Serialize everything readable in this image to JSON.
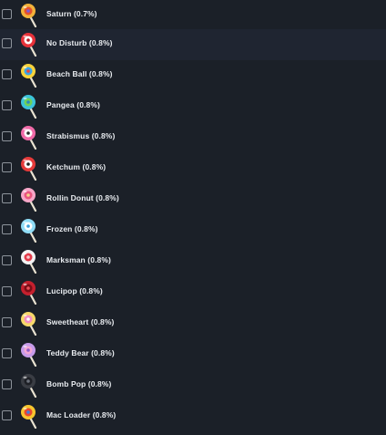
{
  "items": [
    {
      "name": "Saturn (0.7%)",
      "icon": "lollipop-saturn-icon",
      "colors": [
        "#f2b23a",
        "#e4502c",
        "#7b5bd6"
      ],
      "highlighted": false
    },
    {
      "name": "No Disturb (0.8%)",
      "icon": "lollipop-no-disturb-icon",
      "colors": [
        "#e8323a",
        "#ffffff",
        "#b81e26"
      ],
      "highlighted": true
    },
    {
      "name": "Beach Ball (0.8%)",
      "icon": "lollipop-beach-ball-icon",
      "colors": [
        "#f7d23a",
        "#3aa2e8",
        "#e9463a"
      ],
      "highlighted": false
    },
    {
      "name": "Pangea (0.8%)",
      "icon": "lollipop-pangea-icon",
      "colors": [
        "#3cc3d9",
        "#6fd157",
        "#2a8ac0"
      ],
      "highlighted": false
    },
    {
      "name": "Strabismus (0.8%)",
      "icon": "lollipop-strabismus-icon",
      "colors": [
        "#f06aa8",
        "#ffffff",
        "#2a2a2a"
      ],
      "highlighted": false
    },
    {
      "name": "Ketchum (0.8%)",
      "icon": "lollipop-ketchum-icon",
      "colors": [
        "#e53a3a",
        "#ffffff",
        "#222222"
      ],
      "highlighted": false
    },
    {
      "name": "Rollin Donut (0.8%)",
      "icon": "lollipop-rollin-donut-icon",
      "colors": [
        "#f7a6c8",
        "#e9557f",
        "#f5d28a"
      ],
      "highlighted": false
    },
    {
      "name": "Frozen (0.8%)",
      "icon": "lollipop-frozen-icon",
      "colors": [
        "#8fdcf6",
        "#ffffff",
        "#3b9fd8"
      ],
      "highlighted": false
    },
    {
      "name": "Marksman (0.8%)",
      "icon": "lollipop-marksman-icon",
      "colors": [
        "#f3f3f3",
        "#e33b4a",
        "#f7c6cb"
      ],
      "highlighted": false
    },
    {
      "name": "Lucipop (0.8%)",
      "icon": "lollipop-lucipop-icon",
      "colors": [
        "#c4202e",
        "#7a0d16",
        "#e85058"
      ],
      "highlighted": false
    },
    {
      "name": "Sweetheart (0.8%)",
      "icon": "lollipop-sweetheart-icon",
      "colors": [
        "#f7d86a",
        "#f48fc2",
        "#ffffff"
      ],
      "highlighted": false
    },
    {
      "name": "Teddy Bear (0.8%)",
      "icon": "lollipop-teddy-bear-icon",
      "colors": [
        "#c79bea",
        "#f3a6d6",
        "#8a5bc9"
      ],
      "highlighted": false
    },
    {
      "name": "Bomb Pop (0.8%)",
      "icon": "lollipop-bomb-pop-icon",
      "colors": [
        "#3a3d44",
        "#1e2026",
        "#6b707a"
      ],
      "highlighted": false
    },
    {
      "name": "Mac Loader (0.8%)",
      "icon": "lollipop-mac-loader-icon",
      "colors": [
        "#f7c52e",
        "#e8482f",
        "#3b7fe0"
      ],
      "highlighted": false
    }
  ]
}
